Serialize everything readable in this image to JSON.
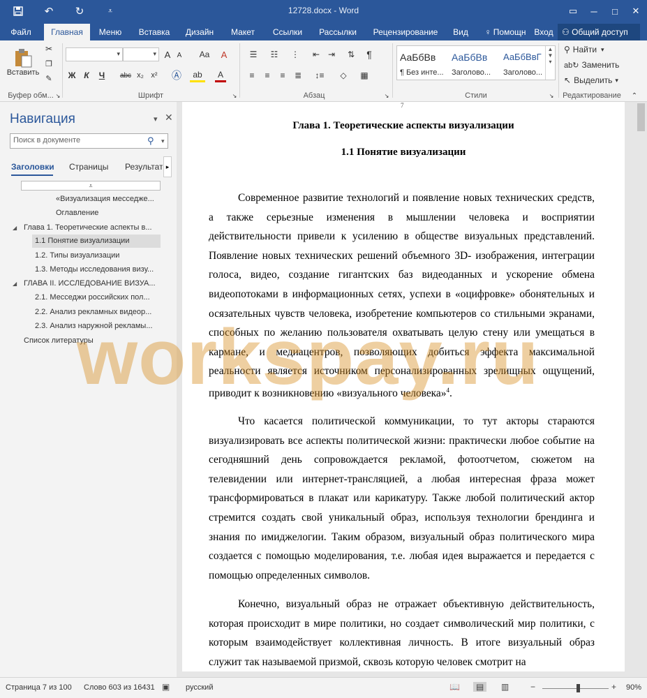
{
  "titlebar": {
    "title": "12728.docx - Word",
    "save_icon": "save-icon",
    "undo_icon": "undo-icon",
    "redo_icon": "redo-icon",
    "customize_icon": "customize-icon"
  },
  "tabs": {
    "items": [
      {
        "label": "Файл"
      },
      {
        "label": "Главная"
      },
      {
        "label": "Меню"
      },
      {
        "label": "Вставка"
      },
      {
        "label": "Дизайн"
      },
      {
        "label": "Макет"
      },
      {
        "label": "Ссылки"
      },
      {
        "label": "Рассылки"
      },
      {
        "label": "Рецензирование"
      },
      {
        "label": "Вид"
      },
      {
        "label": "Помощн"
      },
      {
        "label": "Вход"
      }
    ],
    "share": "Общий доступ"
  },
  "ribbon": {
    "clipboard": {
      "paste": "Вставить",
      "label": "Буфер обм..."
    },
    "font": {
      "label": "Шрифт",
      "bold": "Ж",
      "italic": "К",
      "underline": "Ч",
      "strike": "abc",
      "sub": "x₂",
      "sup": "x²",
      "grow": "A",
      "shrink": "A",
      "case": "Aa",
      "clear": "A"
    },
    "paragraph": {
      "label": "Абзац",
      "pilcrow": "¶"
    },
    "styles": {
      "label": "Стили",
      "items": [
        {
          "sample": "АаБбВв",
          "name": "¶ Без инте..."
        },
        {
          "sample": "АаБбВв",
          "name": "Заголово..."
        },
        {
          "sample": "АаБбВвГ",
          "name": "Заголово..."
        }
      ]
    },
    "editing": {
      "label": "Редактирование",
      "find": "Найти",
      "replace": "Заменить",
      "select": "Выделить"
    }
  },
  "navigation": {
    "title": "Навигация",
    "search_placeholder": "Поиск в документе",
    "tabs": [
      "Заголовки",
      "Страницы",
      "Результате"
    ],
    "items": [
      {
        "text": "«Визуализация месседже..."
      },
      {
        "text": "Оглавление"
      },
      {
        "text": "Глава 1. Теоретические аспекты в..."
      },
      {
        "text": "1.1 Понятие визуализации"
      },
      {
        "text": "1.2. Типы визуализации"
      },
      {
        "text": "1.3. Методы исследования визу..."
      },
      {
        "text": "ГЛАВА II. ИССЛЕДОВАНИЕ ВИЗУА..."
      },
      {
        "text": "2.1. Месседжи российских пол..."
      },
      {
        "text": "2.2. Анализ рекламных видеор..."
      },
      {
        "text": "2.3. Анализ наружной рекламы..."
      },
      {
        "text": "Список литературы"
      }
    ]
  },
  "document": {
    "page_number": "7",
    "chapter_heading": "Глава 1. Теоретические аспекты визуализации",
    "section_heading": "1.1 Понятие визуализации",
    "para1": "Современное развитие технологий и появление новых технических средств, а также серьезные изменения в мышлении человека и восприятии действительности привели к усилению в обществе визуальных представлений. Появление новых технических решений объемного 3D- изображения, интеграции голоса, видео, создание гигантских баз видеоданных и ускорение обмена видеопотоками в информационных сетях, успехи в «оцифровке» обонятельных и осязательных чувств человека, изобретение компьютеров со стильными экранами, способных по желанию пользователя охватывать целую стену или умещаться в кармане, и медиацентров, позволяющих добиться эффекта максимальной реальности является источником персонализированных зрелищных ощущений, приводит к возникновению «визуального человека»",
    "para1_footnote": "4",
    "para1_end": ".",
    "para2": "Что касается политической коммуникации, то тут акторы стараются визуализировать все аспекты политической жизни:            практически любое событие на сегодняшний день сопровождается рекламой, фотоотчетом, сюжетом на телевидении или интернет-трансляцией, а любая интересная фраза может трансформироваться в плакат или карикатуру. Также любой политический актор стремится создать свой уникальный образ, используя технологии брендинга и знания по имиджелогии. Таким образом, визуальный образ политического мира создается с помощью моделирования, т.е. любая идея выражается и передается с помощью определенных символов.",
    "para3": "Конечно, визуальный образ не отражает объективную действительность, которая происходит в мире политики, но создает символический мир политики, с которым взаимодействует коллективная личность. В итоге визуальный образ служит так называемой призмой, сквозь которую человек смотрит на"
  },
  "watermark": "workspay.ru",
  "status": {
    "page": "Страница 7 из 100",
    "words": "Слово 603 из 16431",
    "language": "русский",
    "zoom": "90%",
    "zoom_level": 0.9
  },
  "colors": {
    "accent": "#2b579a",
    "watermark": "#d68c1e"
  }
}
